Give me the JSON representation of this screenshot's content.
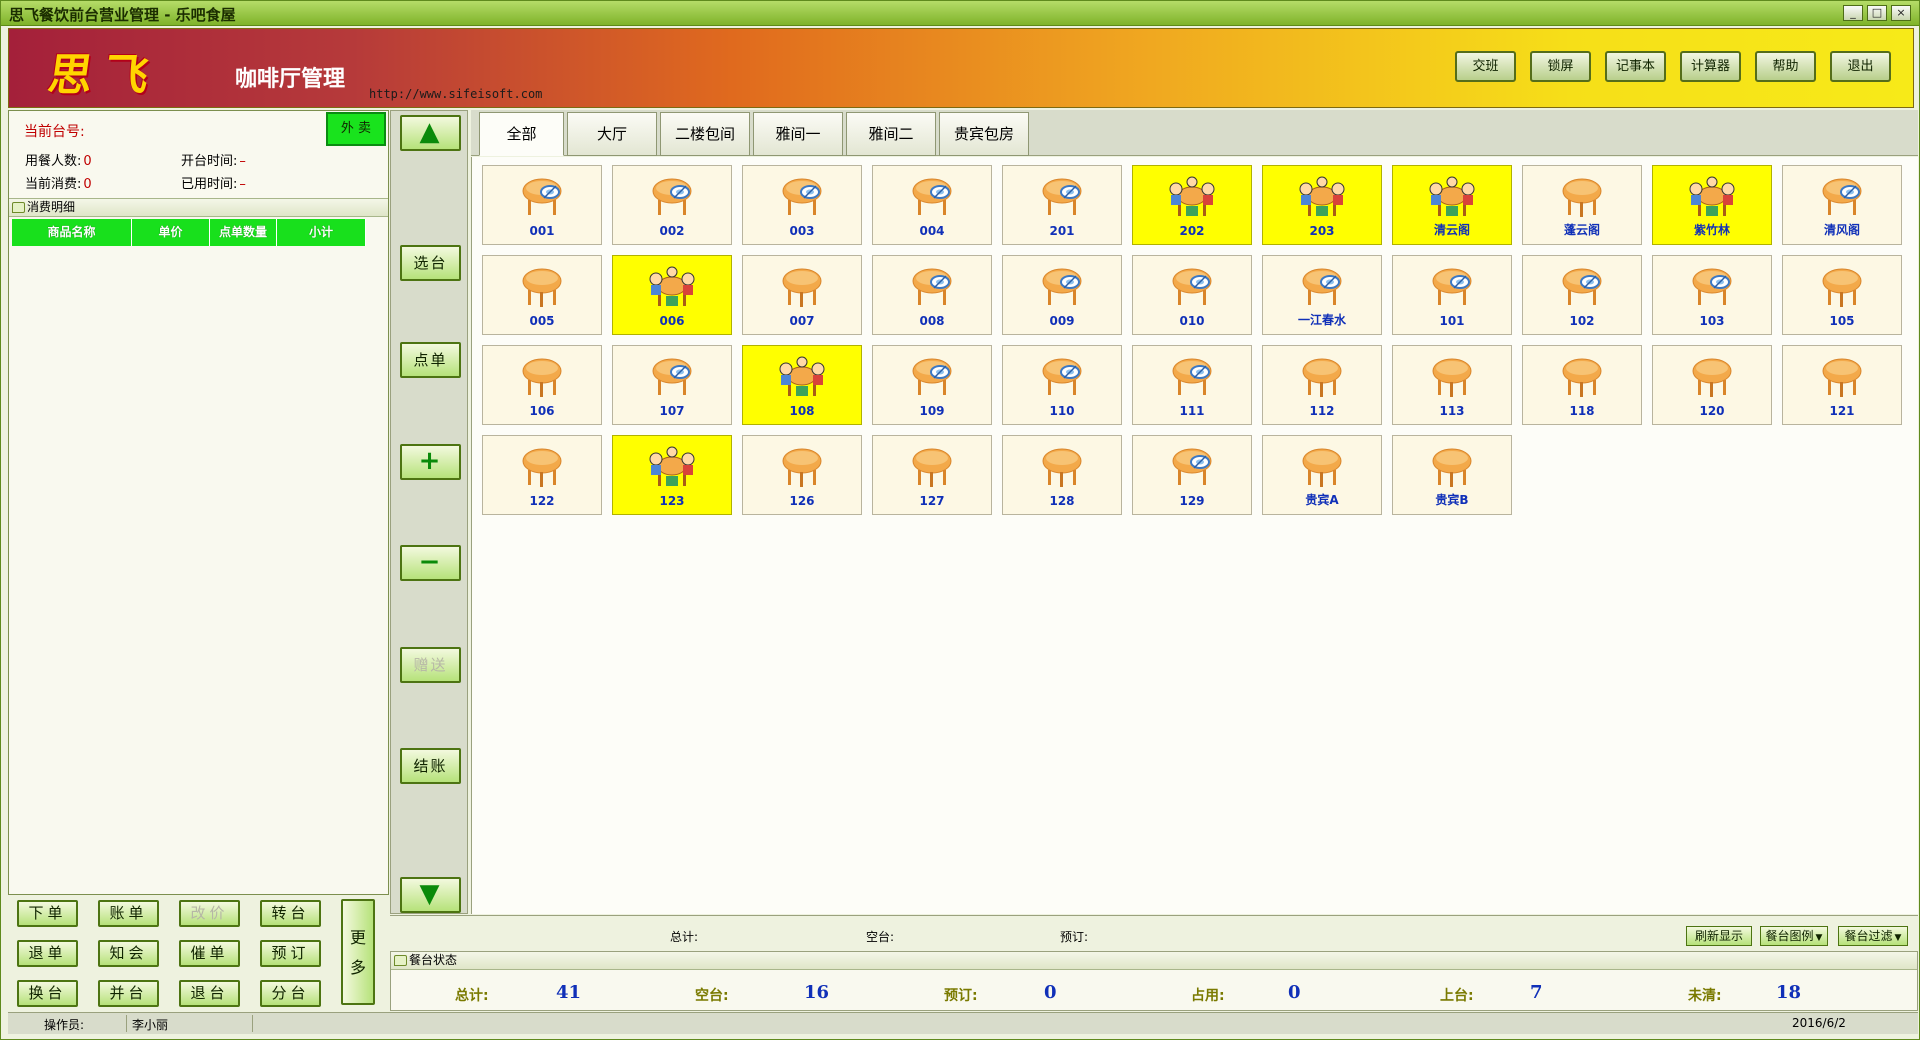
{
  "window": {
    "title": "思飞餐饮前台营业管理 - 乐吧食屋",
    "controls": [
      "_",
      "□",
      "×"
    ]
  },
  "header": {
    "logo": "思飞",
    "app_title": "咖啡厅管理",
    "site": "http://www.sifeisoft.com",
    "buttons": [
      "交班",
      "锁屏",
      "记事本",
      "计算器",
      "帮助",
      "退出"
    ]
  },
  "left": {
    "current_table_label": "当前台号:",
    "takeout": "外 卖",
    "diners_label": "用餐人数:",
    "diners_value": "0",
    "open_time_label": "开台时间:",
    "open_time_value": "–",
    "consumption_label": "当前消费:",
    "consumption_value": "0",
    "used_time_label": "已用时间:",
    "used_time_value": "–",
    "details_title": "消费明细",
    "columns": [
      "商品名称",
      "单价",
      "点单数量",
      "小计"
    ]
  },
  "left_buttons": {
    "order": "下单",
    "bill": "账单",
    "change_price": "改价",
    "transfer": "转台",
    "return_item": "退单",
    "notify": "知会",
    "rush": "催单",
    "reserve": "预订",
    "swap": "换台",
    "merge": "并台",
    "cancel_table": "退台",
    "split": "分台",
    "more": "更多"
  },
  "mid_buttons": {
    "up": "▲",
    "select": "选台",
    "order": "点单",
    "plus": "+",
    "minus": "−",
    "gift": "赠送",
    "checkout": "结账",
    "down": "▼"
  },
  "tabs": [
    "全部",
    "大厅",
    "二楼包间",
    "雅间一",
    "雅间二",
    "贵宾包房"
  ],
  "tables": [
    {
      "name": "001",
      "status": "free"
    },
    {
      "name": "002",
      "status": "free"
    },
    {
      "name": "003",
      "status": "free"
    },
    {
      "name": "004",
      "status": "free"
    },
    {
      "name": "201",
      "status": "free"
    },
    {
      "name": "202",
      "status": "occupied"
    },
    {
      "name": "203",
      "status": "occupied"
    },
    {
      "name": "清云阁",
      "status": "occupied"
    },
    {
      "name": "蓬云阁",
      "status": "empty"
    },
    {
      "name": "紫竹林",
      "status": "occupied"
    },
    {
      "name": "清风阁",
      "status": "free"
    },
    {
      "name": "005",
      "status": "empty"
    },
    {
      "name": "006",
      "status": "occupied"
    },
    {
      "name": "007",
      "status": "empty"
    },
    {
      "name": "008",
      "status": "free"
    },
    {
      "name": "009",
      "status": "free"
    },
    {
      "name": "010",
      "status": "free"
    },
    {
      "name": "一江春水",
      "status": "free"
    },
    {
      "name": "101",
      "status": "free"
    },
    {
      "name": "102",
      "status": "free"
    },
    {
      "name": "103",
      "status": "free"
    },
    {
      "name": "105",
      "status": "empty"
    },
    {
      "name": "106",
      "status": "empty"
    },
    {
      "name": "107",
      "status": "free"
    },
    {
      "name": "108",
      "status": "occupied"
    },
    {
      "name": "109",
      "status": "free"
    },
    {
      "name": "110",
      "status": "free"
    },
    {
      "name": "111",
      "status": "free"
    },
    {
      "name": "112",
      "status": "empty"
    },
    {
      "name": "113",
      "status": "empty"
    },
    {
      "name": "118",
      "status": "empty"
    },
    {
      "name": "120",
      "status": "empty"
    },
    {
      "name": "121",
      "status": "empty"
    },
    {
      "name": "122",
      "status": "empty"
    },
    {
      "name": "123",
      "status": "occupied"
    },
    {
      "name": "126",
      "status": "empty"
    },
    {
      "name": "127",
      "status": "empty"
    },
    {
      "name": "128",
      "status": "empty"
    },
    {
      "name": "129",
      "status": "free"
    },
    {
      "name": "贵宾A",
      "status": "empty"
    },
    {
      "name": "贵宾B",
      "status": "empty"
    }
  ],
  "status_bar": {
    "total": "总计:",
    "free": "空台:",
    "reserved": "预订:",
    "refresh": "刷新显示",
    "legend": "餐台图例",
    "filter": "餐台过滤"
  },
  "table_state": {
    "title": "餐台状态",
    "items": [
      {
        "label": "总计:",
        "value": "41"
      },
      {
        "label": "空台:",
        "value": "16"
      },
      {
        "label": "预订:",
        "value": "0"
      },
      {
        "label": "占用:",
        "value": "0"
      },
      {
        "label": "上台:",
        "value": "7"
      },
      {
        "label": "未清:",
        "value": "18"
      }
    ]
  },
  "footer": {
    "operator_label": "操作员:",
    "operator": "李小丽",
    "date": "2016/6/2"
  },
  "colors": {
    "occupied": "#ffff00",
    "free": "#fdf8e4",
    "accent_green": "#18e01c",
    "table_text": "#1030b8"
  },
  "icons": {
    "table": "round-table-icon",
    "occupied": "table-with-diners-icon",
    "free": "table-with-tableware-icon"
  }
}
